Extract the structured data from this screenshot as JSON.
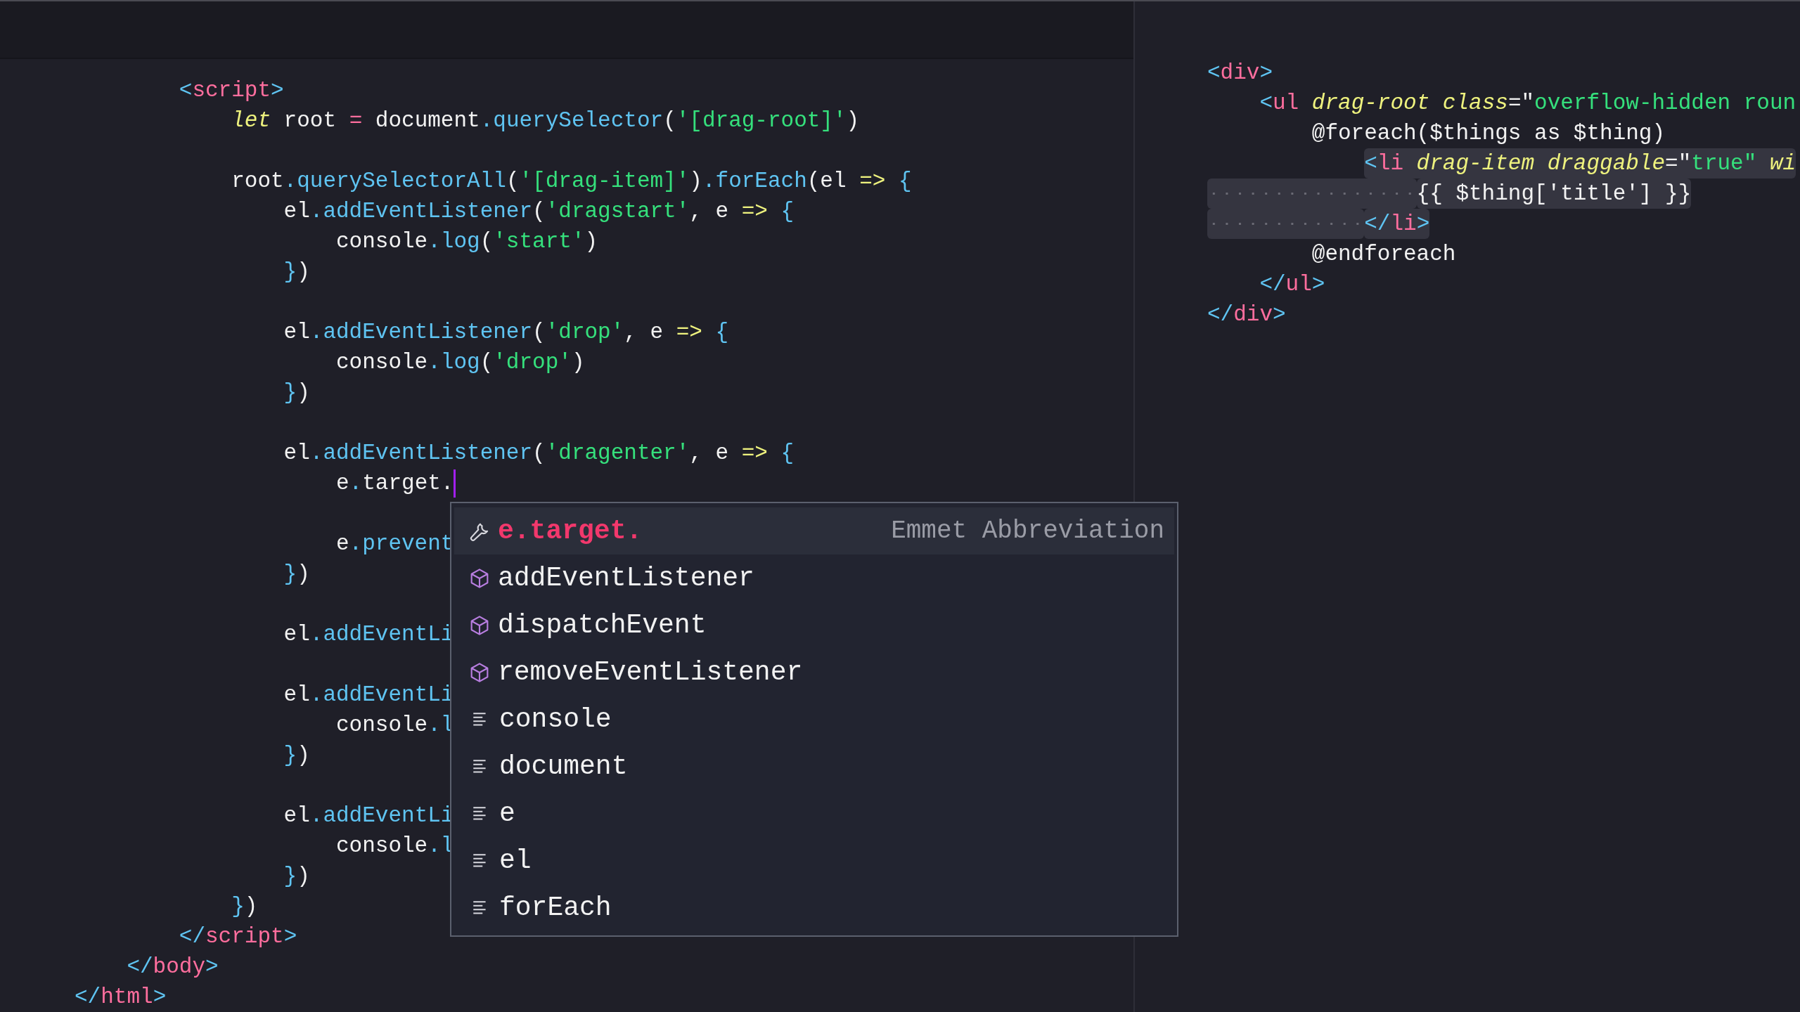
{
  "left_pane": {
    "lines": [
      {
        "children": [
          {
            "children": [
              {
                "tokens": [
                  {
                    "kind": "punct",
                    "text": "<"
                  },
                  {
                    "kind": "tag",
                    "text": "script"
                  },
                  {
                    "kind": "punct",
                    "text": ">"
                  }
                ]
              },
              {
                "children": [
                  {
                    "tokens": [
                      {
                        "kind": "keyword",
                        "text": "let"
                      },
                      {
                        "kind": "plain",
                        "text": " root "
                      },
                      {
                        "kind": "op",
                        "text": "="
                      },
                      {
                        "kind": "plain",
                        "text": " document"
                      },
                      {
                        "kind": "punct",
                        "text": ".querySelector"
                      },
                      {
                        "kind": "plain",
                        "text": "("
                      },
                      {
                        "kind": "string",
                        "text": "'[drag-root]'"
                      },
                      {
                        "kind": "plain",
                        "text": ")"
                      }
                    ]
                  },
                  {
                    "space_before": true,
                    "tokens": [
                      {
                        "kind": "plain",
                        "text": "root"
                      },
                      {
                        "kind": "punct",
                        "text": ".querySelectorAll"
                      },
                      {
                        "kind": "plain",
                        "text": "("
                      },
                      {
                        "kind": "string",
                        "text": "'[drag-item]'"
                      },
                      {
                        "kind": "plain",
                        "text": ")"
                      },
                      {
                        "kind": "punct",
                        "text": ".forEach"
                      },
                      {
                        "kind": "plain",
                        "text": "(el "
                      },
                      {
                        "kind": "arrow",
                        "text": "=>"
                      },
                      {
                        "kind": "punct",
                        "text": " {"
                      }
                    ]
                  },
                  {
                    "children": [
                      {
                        "tokens": [
                          {
                            "kind": "plain",
                            "text": "el"
                          },
                          {
                            "kind": "punct",
                            "text": ".addEventListener"
                          },
                          {
                            "kind": "plain",
                            "text": "("
                          },
                          {
                            "kind": "string",
                            "text": "'dragstart'"
                          },
                          {
                            "kind": "plain",
                            "text": ", e "
                          },
                          {
                            "kind": "arrow",
                            "text": "=>"
                          },
                          {
                            "kind": "punct",
                            "text": " {"
                          }
                        ]
                      },
                      {
                        "children": [
                          {
                            "tokens": [
                              {
                                "kind": "plain",
                                "text": "console"
                              },
                              {
                                "kind": "punct",
                                "text": ".log"
                              },
                              {
                                "kind": "plain",
                                "text": "("
                              },
                              {
                                "kind": "string",
                                "text": "'start'"
                              },
                              {
                                "kind": "plain",
                                "text": ")"
                              }
                            ]
                          }
                        ]
                      },
                      {
                        "tokens": [
                          {
                            "kind": "punct",
                            "text": "}"
                          },
                          {
                            "kind": "plain",
                            "text": ")"
                          }
                        ]
                      },
                      {
                        "space_before": true,
                        "tokens": [
                          {
                            "kind": "plain",
                            "text": "el"
                          },
                          {
                            "kind": "punct",
                            "text": ".addEventListener"
                          },
                          {
                            "kind": "plain",
                            "text": "("
                          },
                          {
                            "kind": "string",
                            "text": "'drop'"
                          },
                          {
                            "kind": "plain",
                            "text": ", e "
                          },
                          {
                            "kind": "arrow",
                            "text": "=>"
                          },
                          {
                            "kind": "punct",
                            "text": " {"
                          }
                        ]
                      },
                      {
                        "children": [
                          {
                            "tokens": [
                              {
                                "kind": "plain",
                                "text": "console"
                              },
                              {
                                "kind": "punct",
                                "text": ".log"
                              },
                              {
                                "kind": "plain",
                                "text": "("
                              },
                              {
                                "kind": "string",
                                "text": "'drop'"
                              },
                              {
                                "kind": "plain",
                                "text": ")"
                              }
                            ]
                          }
                        ]
                      },
                      {
                        "tokens": [
                          {
                            "kind": "punct",
                            "text": "}"
                          },
                          {
                            "kind": "plain",
                            "text": ")"
                          }
                        ]
                      },
                      {
                        "space_before": true,
                        "tokens": [
                          {
                            "kind": "plain",
                            "text": "el"
                          },
                          {
                            "kind": "punct",
                            "text": ".addEventListener"
                          },
                          {
                            "kind": "plain",
                            "text": "("
                          },
                          {
                            "kind": "string",
                            "text": "'dragenter'"
                          },
                          {
                            "kind": "plain",
                            "text": ", e "
                          },
                          {
                            "kind": "arrow",
                            "text": "=>"
                          },
                          {
                            "kind": "punct",
                            "text": " {"
                          }
                        ]
                      },
                      {
                        "children": [
                          {
                            "cursor": true,
                            "tokens": [
                              {
                                "kind": "plain",
                                "text": "e"
                              },
                              {
                                "kind": "punct",
                                "text": "."
                              },
                              {
                                "kind": "plain",
                                "text": "target."
                              }
                            ]
                          },
                          {
                            "space_before": true,
                            "tokens": [
                              {
                                "kind": "plain",
                                "text": "e"
                              },
                              {
                                "kind": "punct",
                                "text": ".prevent"
                              }
                            ]
                          }
                        ]
                      },
                      {
                        "tokens": [
                          {
                            "kind": "punct",
                            "text": "}"
                          },
                          {
                            "kind": "plain",
                            "text": ")"
                          }
                        ]
                      },
                      {
                        "space_before": true,
                        "tokens": [
                          {
                            "kind": "plain",
                            "text": "el"
                          },
                          {
                            "kind": "punct",
                            "text": ".addEventLi"
                          }
                        ]
                      },
                      {
                        "space_before": true,
                        "tokens": [
                          {
                            "kind": "plain",
                            "text": "el"
                          },
                          {
                            "kind": "punct",
                            "text": ".addEventLi"
                          }
                        ]
                      },
                      {
                        "children": [
                          {
                            "tokens": [
                              {
                                "kind": "plain",
                                "text": "console"
                              },
                              {
                                "kind": "punct",
                                "text": ".l"
                              }
                            ]
                          }
                        ]
                      },
                      {
                        "tokens": [
                          {
                            "kind": "punct",
                            "text": "}"
                          },
                          {
                            "kind": "plain",
                            "text": ")"
                          }
                        ]
                      },
                      {
                        "space_before": true,
                        "tokens": [
                          {
                            "kind": "plain",
                            "text": "el"
                          },
                          {
                            "kind": "punct",
                            "text": ".addEventLi"
                          }
                        ]
                      },
                      {
                        "children": [
                          {
                            "tokens": [
                              {
                                "kind": "plain",
                                "text": "console"
                              },
                              {
                                "kind": "punct",
                                "text": ".l"
                              }
                            ]
                          }
                        ]
                      },
                      {
                        "tokens": [
                          {
                            "kind": "punct",
                            "text": "}"
                          },
                          {
                            "kind": "plain",
                            "text": ")"
                          }
                        ]
                      }
                    ]
                  },
                  {
                    "tokens": [
                      {
                        "kind": "punct",
                        "text": "}"
                      },
                      {
                        "kind": "plain",
                        "text": ")"
                      }
                    ]
                  }
                ]
              },
              {
                "tokens": [
                  {
                    "kind": "punct",
                    "text": "</"
                  },
                  {
                    "kind": "tag",
                    "text": "script"
                  },
                  {
                    "kind": "punct",
                    "text": ">"
                  }
                ]
              }
            ]
          },
          {
            "tokens": [
              {
                "kind": "punct",
                "text": "</"
              },
              {
                "kind": "tag",
                "text": "body"
              },
              {
                "kind": "punct",
                "text": ">"
              }
            ]
          }
        ]
      },
      {
        "tokens": [
          {
            "kind": "punct",
            "text": "</"
          },
          {
            "kind": "tag",
            "text": "html"
          },
          {
            "kind": "punct",
            "text": ">"
          }
        ]
      }
    ]
  },
  "autocomplete": {
    "items": [
      {
        "kind": "emmet",
        "label": "e.target.",
        "detail": "Emmet Abbreviation",
        "selected": true
      },
      {
        "kind": "method",
        "label": "addEventListener",
        "selected": false
      },
      {
        "kind": "method",
        "label": "dispatchEvent",
        "selected": false
      },
      {
        "kind": "method",
        "label": "removeEventListener",
        "selected": false
      },
      {
        "kind": "text",
        "label": "console",
        "selected": false
      },
      {
        "kind": "text",
        "label": "document",
        "selected": false
      },
      {
        "kind": "text",
        "label": "e",
        "selected": false
      },
      {
        "kind": "text",
        "label": "el",
        "selected": false
      },
      {
        "kind": "text",
        "label": "forEach",
        "selected": false
      }
    ]
  },
  "right_pane": {
    "lines": [
      {
        "selected": false,
        "tokens": [
          {
            "kind": "punct",
            "text": "<"
          },
          {
            "kind": "tag",
            "text": "div"
          },
          {
            "kind": "punct",
            "text": ">"
          }
        ]
      },
      {
        "children": [
          {
            "selected": false,
            "indent_selected": false,
            "tokens": [
              {
                "kind": "punct",
                "text": "<"
              },
              {
                "kind": "tag",
                "text": "ul"
              },
              {
                "kind": "attr",
                "text": " drag-root class"
              },
              {
                "kind": "plain",
                "text": "=\""
              },
              {
                "kind": "string",
                "text": "overflow-hidden roun"
              }
            ]
          },
          {
            "children": [
              {
                "selected": false,
                "indent_selected": false,
                "tokens": [
                  {
                    "kind": "plain",
                    "text": "@foreach($things as $thing)"
                  }
                ]
              },
              {
                "children": [
                  {
                    "selected": true,
                    "indent_selected": false,
                    "tokens": [
                      {
                        "kind": "punct",
                        "text": "<"
                      },
                      {
                        "kind": "tag",
                        "text": "li"
                      },
                      {
                        "kind": "attr",
                        "text": " drag-item draggable"
                      },
                      {
                        "kind": "plain",
                        "text": "=\""
                      },
                      {
                        "kind": "string",
                        "text": "true\""
                      },
                      {
                        "kind": "attr",
                        "text": " wi"
                      }
                    ]
                  },
                  {
                    "children": [
                      {
                        "selected": true,
                        "indent_selected": true,
                        "tokens": [
                          {
                            "kind": "plain",
                            "text": "{{ $thing['title'] }}"
                          }
                        ]
                      }
                    ]
                  },
                  {
                    "selected": true,
                    "indent_selected": true,
                    "tokens": [
                      {
                        "kind": "punct",
                        "text": "</"
                      },
                      {
                        "kind": "tag",
                        "text": "li"
                      },
                      {
                        "kind": "punct",
                        "text": ">"
                      }
                    ]
                  }
                ]
              },
              {
                "selected": false,
                "indent_selected": false,
                "tokens": [
                  {
                    "kind": "plain",
                    "text": "@endforeach"
                  }
                ]
              }
            ]
          },
          {
            "selected": false,
            "indent_selected": false,
            "tokens": [
              {
                "kind": "punct",
                "text": "</"
              },
              {
                "kind": "tag",
                "text": "ul"
              },
              {
                "kind": "punct",
                "text": ">"
              }
            ]
          }
        ]
      },
      {
        "selected": false,
        "tokens": [
          {
            "kind": "punct",
            "text": "</"
          },
          {
            "kind": "tag",
            "text": "div"
          },
          {
            "kind": "punct",
            "text": ">"
          }
        ]
      }
    ]
  }
}
